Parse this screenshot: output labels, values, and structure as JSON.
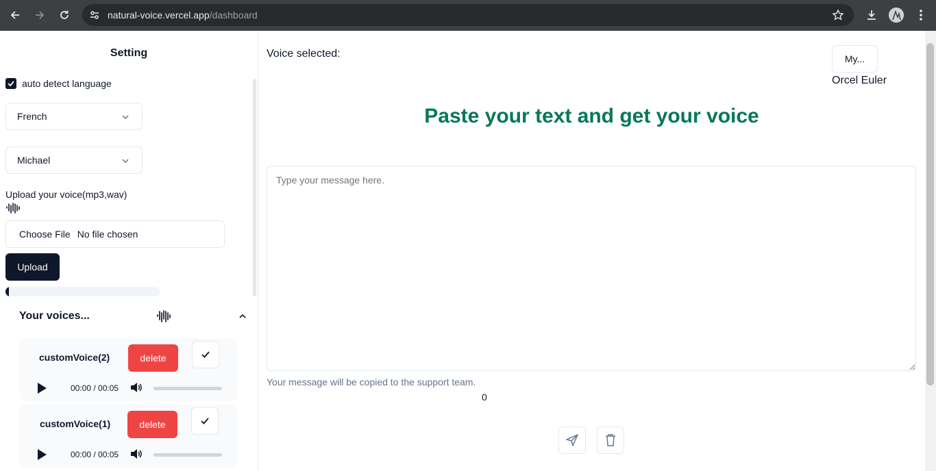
{
  "browser": {
    "url_host": "natural-voice.vercel.app",
    "url_path": "/dashboard"
  },
  "sidebar": {
    "title": "Setting",
    "auto_detect_label": "auto detect language",
    "auto_detect_checked": true,
    "language_select": "French",
    "voice_select": "Michael",
    "upload_label": "Upload your voice(mp3,wav)",
    "file_choose_label": "Choose File",
    "file_status": "No file chosen",
    "upload_button": "Upload",
    "upload_progress": 0.02,
    "voices_title": "Your voices...",
    "voices": [
      {
        "name": "customVoice(2)",
        "delete_label": "delete",
        "time": "00:00 / 00:05"
      },
      {
        "name": "customVoice(1)",
        "delete_label": "delete",
        "time": "00:00 / 00:05"
      }
    ]
  },
  "main": {
    "voice_selected_label": "Voice selected:",
    "my_button": "My...",
    "user_name": "Orcel Euler",
    "headline": "Paste your text and get your voice",
    "message_placeholder": "Type your message here.",
    "hint": "Your message will be copied to the support team.",
    "char_count": "0"
  },
  "colors": {
    "accent_green": "#047857",
    "primary_dark": "#0f172a",
    "danger": "#ef4444"
  }
}
